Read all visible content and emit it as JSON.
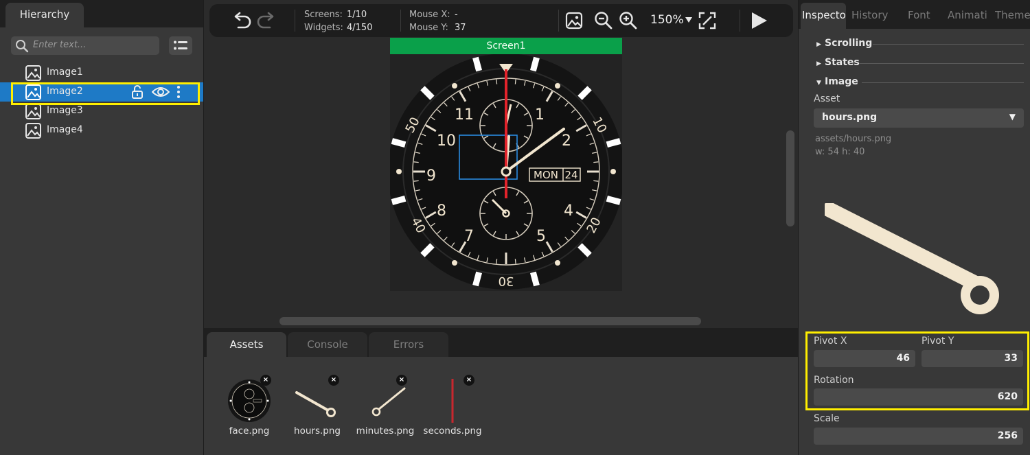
{
  "hierarchy": {
    "tab_label": "Hierarchy",
    "search_placeholder": "Enter text...",
    "items": [
      {
        "label": "Image1"
      },
      {
        "label": "Image2"
      },
      {
        "label": "Image3"
      },
      {
        "label": "Image4"
      }
    ]
  },
  "toolbar": {
    "screens_label": "Screens:",
    "screens_value": "1/10",
    "widgets_label": "Widgets:",
    "widgets_value": "4/150",
    "mouse_x_label": "Mouse X:",
    "mouse_x_value": "-",
    "mouse_y_label": "Mouse Y:",
    "mouse_y_value": "37",
    "zoom_value": "150%"
  },
  "canvas": {
    "screen_label": "Screen1",
    "watch": {
      "hour_numerals": [
        "11",
        "1",
        "10",
        "2",
        "9",
        "8",
        "4",
        "7",
        "5"
      ],
      "bezel_numerals": [
        "50",
        "10",
        "40",
        "20",
        "30"
      ],
      "date_window": [
        "MON",
        "24"
      ]
    }
  },
  "bottom_panel": {
    "tabs": [
      {
        "label": "Assets"
      },
      {
        "label": "Console"
      },
      {
        "label": "Errors"
      }
    ],
    "assets": [
      {
        "name": "face.png"
      },
      {
        "name": "hours.png"
      },
      {
        "name": "minutes.png"
      },
      {
        "name": "seconds.png"
      }
    ]
  },
  "inspector": {
    "tabs": [
      {
        "label": "Inspecto"
      },
      {
        "label": "History"
      },
      {
        "label": "Font"
      },
      {
        "label": "Animati"
      },
      {
        "label": "Themes"
      }
    ],
    "sections": {
      "scrolling": "Scrolling",
      "states": "States",
      "image": "Image"
    },
    "asset_label": "Asset",
    "asset_value": "hours.png",
    "asset_path": "assets/hours.png",
    "asset_size": "w: 54  h: 40",
    "pivot_x_label": "Pivot X",
    "pivot_x_value": "46",
    "pivot_y_label": "Pivot Y",
    "pivot_y_value": "33",
    "rotation_label": "Rotation",
    "rotation_value": "620",
    "scale_label": "Scale",
    "scale_value": "256"
  },
  "colors": {
    "selection": "#1e7ac6",
    "screen_tab": "#0aa04a",
    "highlight": "#ffee00",
    "hand_cream": "#f2e6cf",
    "second_hand": "#e3232b"
  }
}
